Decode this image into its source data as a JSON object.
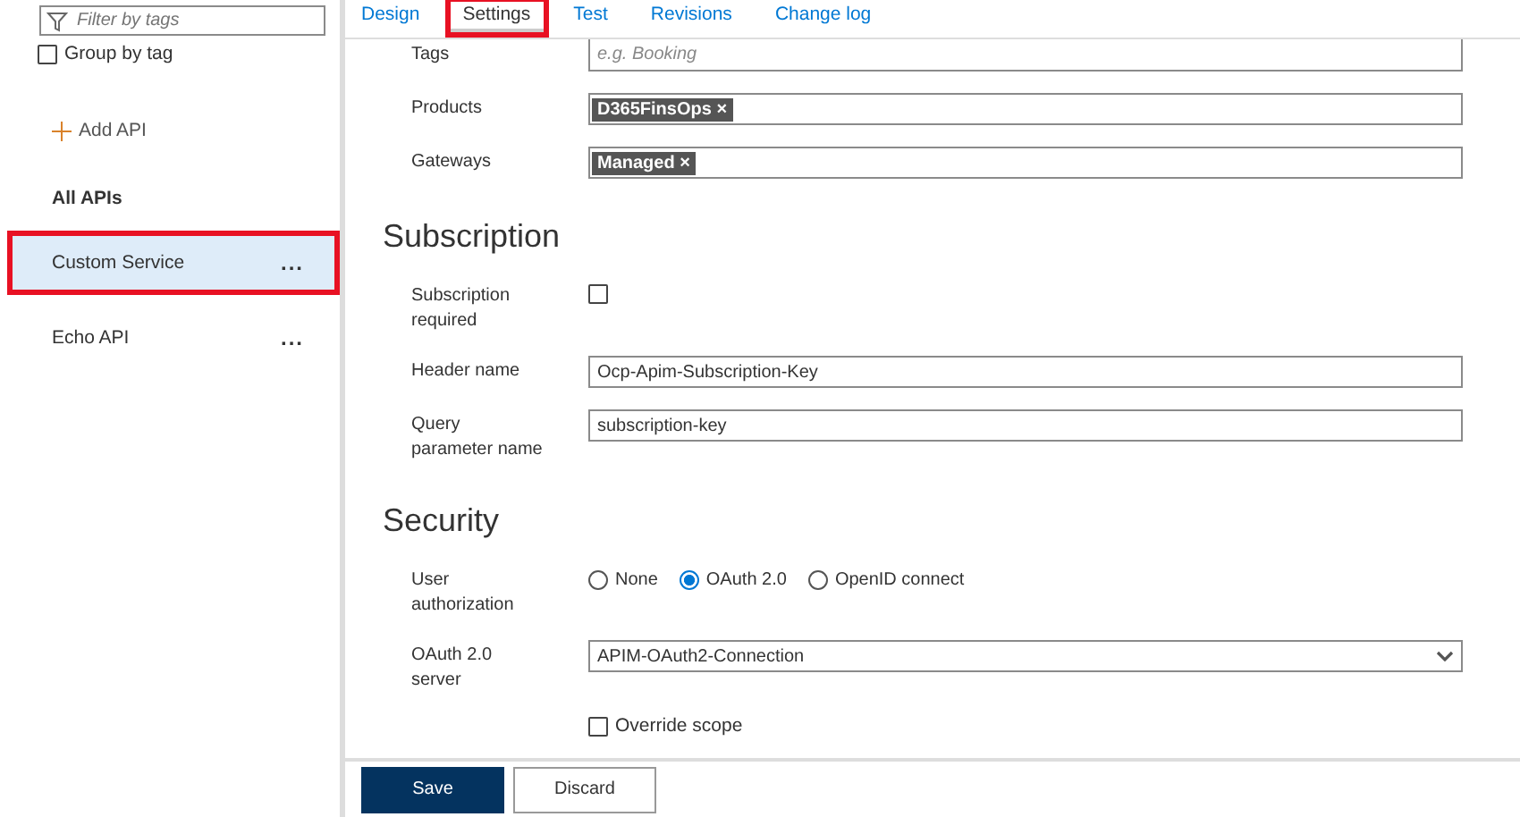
{
  "sidebar": {
    "filter": {
      "placeholder": "Filter by tags"
    },
    "group_by_tag": {
      "label": "Group by tag",
      "checked": false
    },
    "add_api": "Add API",
    "section_title": "All APIs",
    "apis": [
      {
        "name": "Custom Service",
        "more": "...",
        "selected": true,
        "highlighted": true
      },
      {
        "name": "Echo API",
        "more": "...",
        "selected": false,
        "highlighted": false
      }
    ]
  },
  "tabs": [
    {
      "label": "Design",
      "selected": false,
      "highlighted": false
    },
    {
      "label": "Settings",
      "selected": true,
      "highlighted": true
    },
    {
      "label": "Test",
      "selected": false,
      "highlighted": false
    },
    {
      "label": "Revisions",
      "selected": false,
      "highlighted": false
    },
    {
      "label": "Change log",
      "selected": false,
      "highlighted": false
    }
  ],
  "general": [
    {
      "label": "Tags",
      "kind": "text",
      "placeholder": "e.g. Booking"
    },
    {
      "label": "Products",
      "kind": "chips",
      "chips": [
        {
          "label": "D365FinsOps",
          "remove": "×"
        }
      ]
    },
    {
      "label": "Gateways",
      "kind": "chips",
      "chips": [
        {
          "label": "Managed",
          "remove": "×"
        }
      ]
    }
  ],
  "subscription": {
    "title": "Subscription",
    "fields": [
      {
        "label": "Subscription required",
        "kind": "checkbox",
        "checked": false
      },
      {
        "label": "Header name",
        "kind": "text",
        "value": "Ocp-Apim-Subscription-Key"
      },
      {
        "label": "Query parameter name",
        "kind": "text",
        "value": "subscription-key"
      }
    ]
  },
  "security": {
    "title": "Security",
    "fields": [
      {
        "label": "User authorization",
        "kind": "radio",
        "options": [
          {
            "label": "None",
            "selected": false
          },
          {
            "label": "OAuth 2.0",
            "selected": true
          },
          {
            "label": "OpenID connect",
            "selected": false
          }
        ]
      },
      {
        "label": "OAuth 2.0 server",
        "kind": "select",
        "value": "APIM-OAuth2-Connection"
      },
      {
        "kind": "checkbox_inline",
        "option": "Override scope",
        "checked": false
      }
    ]
  },
  "buttons": [
    {
      "label": "Save",
      "kind": "primary"
    },
    {
      "label": "Discard",
      "kind": "secondary"
    }
  ]
}
